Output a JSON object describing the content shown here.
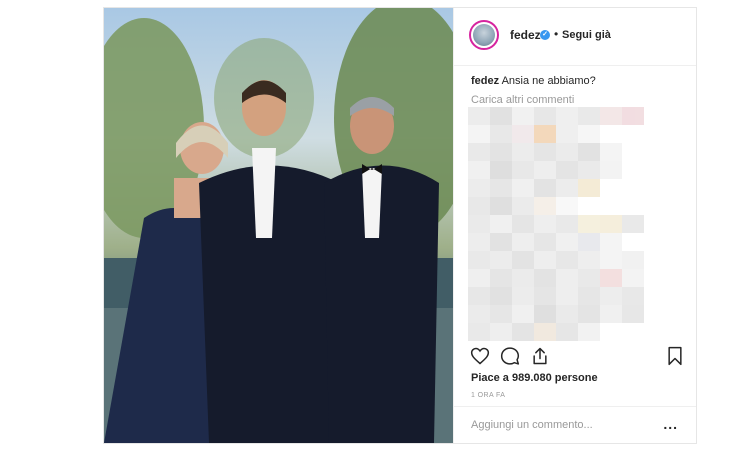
{
  "post": {
    "username": "fedez",
    "verified_mark": "✓",
    "separator": "•",
    "follow_label": "Segui già",
    "caption_user": "fedez",
    "caption_text": "Ansia ne abbiamo?",
    "load_more": "Carica altri commenti",
    "likes": "Piace a 989.080 persone",
    "timestamp": "1 ORA FA",
    "comment_placeholder": "Aggiungi un commento...",
    "more_options": "..."
  },
  "icons": {
    "like": "heart-icon",
    "comment": "comment-icon",
    "share": "share-icon",
    "save": "bookmark-icon"
  },
  "colors": {
    "verified": "#3897f0",
    "avatar_ring": "#d6249f",
    "muted_text": "#999999",
    "text": "#262626"
  }
}
